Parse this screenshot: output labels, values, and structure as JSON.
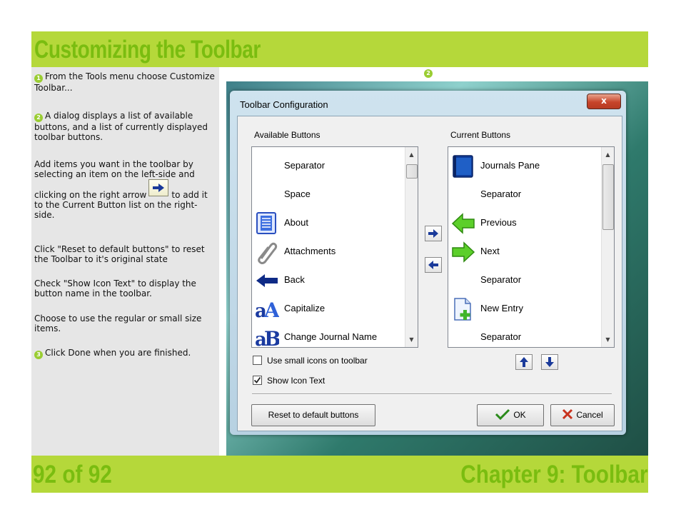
{
  "header": {
    "title": "Customizing the Toolbar"
  },
  "instructions": {
    "step1_badge": "1",
    "step1": "From the Tools menu choose Customize Toolbar...",
    "step2_badge": "2",
    "step2": "A dialog displays a list of available buttons, and a list of currently displayed toolbar buttons.",
    "add_items_pre": "Add items you want in the toolbar by selecting an item on the left-side and clicking on the right arrow",
    "add_items_post": "to add it to the Current Button list on the right-side.",
    "reset": "Click \"Reset to default buttons\" to reset the Toolbar to it's original state",
    "show_icon_text": "Check \"Show Icon Text\" to display the button name in the toolbar.",
    "size": "Choose to use the regular or small size items.",
    "step3_badge": "3",
    "step3": "Click Done when you are finished."
  },
  "screenshot_badge": "2",
  "dialog": {
    "title": "Toolbar Configuration",
    "close_label": "x",
    "available_label": "Available Buttons",
    "current_label": "Current Buttons",
    "available_items": [
      {
        "label": "Separator",
        "icon": "none"
      },
      {
        "label": "Space",
        "icon": "none"
      },
      {
        "label": "About",
        "icon": "about-icon"
      },
      {
        "label": "Attachments",
        "icon": "paperclip-icon"
      },
      {
        "label": "Back",
        "icon": "back-arrow-icon"
      },
      {
        "label": "Capitalize",
        "icon": "capitalize-icon"
      },
      {
        "label": "Change Journal Name",
        "icon": "change-journal-name-icon"
      }
    ],
    "current_items": [
      {
        "label": "Journals Pane",
        "icon": "journal-book-icon"
      },
      {
        "label": "Separator",
        "icon": "none"
      },
      {
        "label": "Previous",
        "icon": "previous-arrow-icon"
      },
      {
        "label": "Next",
        "icon": "next-arrow-icon"
      },
      {
        "label": "Separator",
        "icon": "none"
      },
      {
        "label": "New Entry",
        "icon": "new-entry-icon"
      },
      {
        "label": "Separator",
        "icon": "none"
      }
    ],
    "small_icons_label": "Use small icons on toolbar",
    "small_icons_checked": false,
    "show_icon_text_label": "Show Icon Text",
    "show_icon_text_checked": true,
    "reset_label": "Reset to default buttons",
    "ok_label": "OK",
    "cancel_label": "Cancel"
  },
  "footer": {
    "page": "92 of 92",
    "chapter": "Chapter 9: Toolbar"
  },
  "colors": {
    "band": "#b5d83a",
    "title": "#7abd10",
    "badge": "#9acd32"
  }
}
